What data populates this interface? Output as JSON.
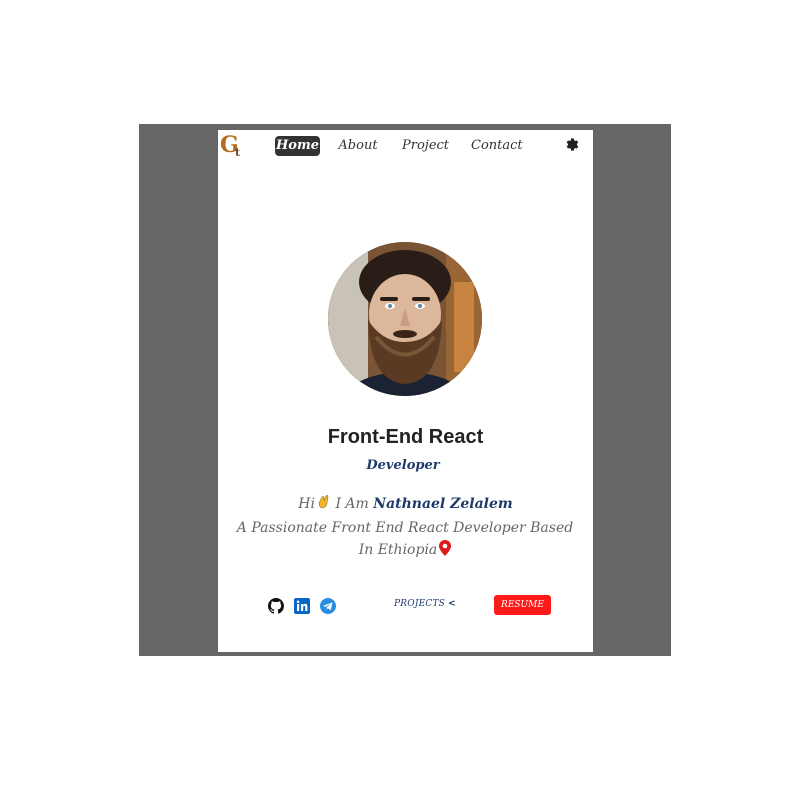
{
  "brand": {
    "logo_main": "G",
    "logo_small": "t"
  },
  "nav": {
    "home": "Home",
    "about": "About",
    "project": "Project",
    "contact": "Contact"
  },
  "hero": {
    "title": "Front-End React",
    "role": "Developer",
    "greeting": "Hi",
    "i_am": "I Am",
    "name": "Nathnael Zelalem",
    "description": "A Passionate Front End React Developer Based In Ethiopia"
  },
  "actions": {
    "projects": "PROJECTS",
    "projects_arrow": "<",
    "resume": "RESUME"
  },
  "icons": {
    "settings": "gear-icon",
    "github": "github-icon",
    "linkedin": "linkedin-icon",
    "telegram": "telegram-icon",
    "location": "location-pin-icon",
    "wave": "waving-hand-icon"
  },
  "colors": {
    "accent": "#1e3a6b",
    "resume_button": "#ff1a1a",
    "active_nav": "#333333",
    "backdrop": "#666666"
  }
}
